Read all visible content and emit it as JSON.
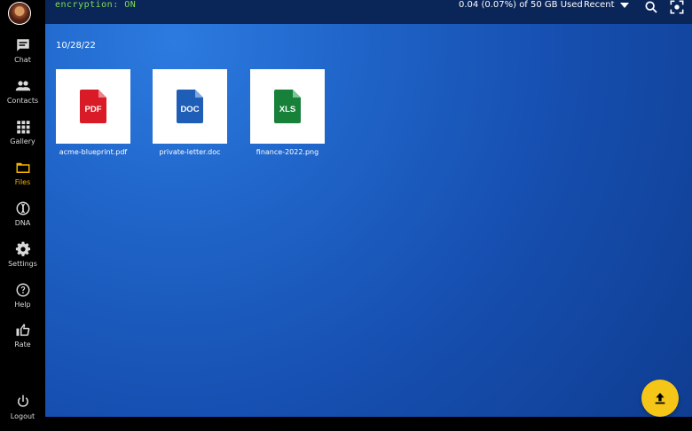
{
  "header": {
    "encryption": "encryption: ON",
    "usage": "0.04 (0.07%) of 50 GB Used",
    "sort": "Recent"
  },
  "sidebar": {
    "items": [
      {
        "label": "Chat",
        "icon": "chat-icon"
      },
      {
        "label": "Contacts",
        "icon": "contacts-icon"
      },
      {
        "label": "Gallery",
        "icon": "gallery-icon"
      },
      {
        "label": "Files",
        "icon": "folder-icon",
        "active": true
      },
      {
        "label": "DNA",
        "icon": "dna-icon"
      },
      {
        "label": "Settings",
        "icon": "gear-icon"
      },
      {
        "label": "Help",
        "icon": "help-icon"
      },
      {
        "label": "Rate",
        "icon": "thumbs-up-icon"
      },
      {
        "label": "Logout",
        "icon": "power-icon"
      }
    ]
  },
  "main": {
    "date": "10/28/22",
    "files": [
      {
        "name": "acme-blueprint.pdf",
        "badge": "PDF",
        "color": "#d81b26"
      },
      {
        "name": "private-letter.doc",
        "badge": "DOC",
        "color": "#1e5eb6"
      },
      {
        "name": "finance-2022.png",
        "badge": "XLS",
        "color": "#17813a"
      }
    ]
  },
  "colors": {
    "accent": "#f2b200",
    "topbar": "#0a2558"
  }
}
